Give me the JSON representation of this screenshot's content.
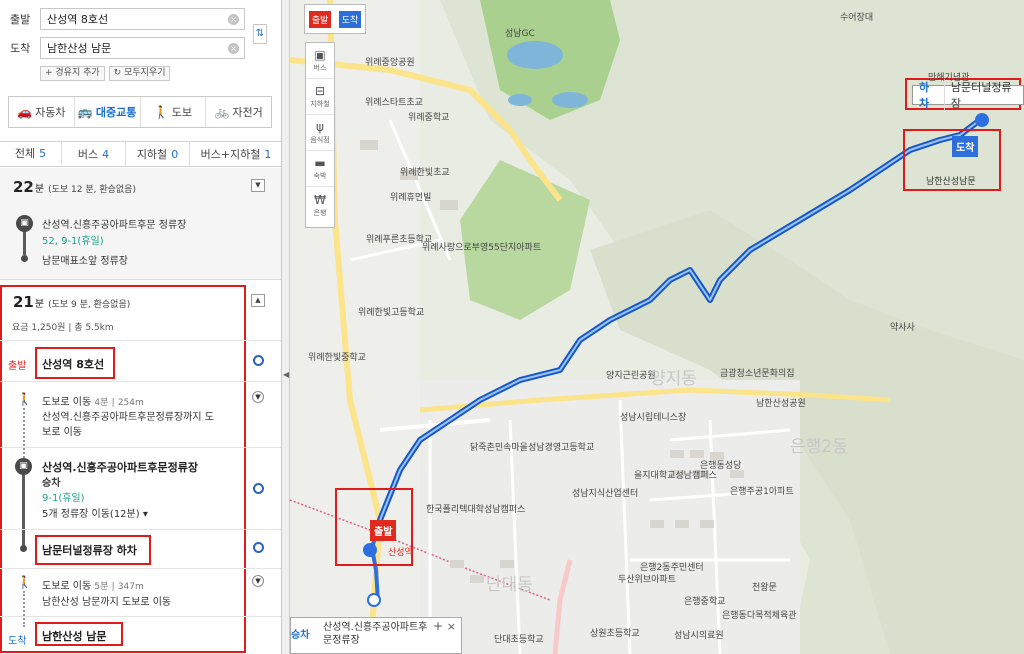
{
  "search": {
    "origin_label": "출발",
    "origin_value": "산성역 8호선",
    "destination_label": "도착",
    "destination_value": "남한산성 남문",
    "add_waypoint": "+ 경유지 추가",
    "clear_all": "모두지우기"
  },
  "modes": [
    {
      "label": "자동차",
      "icon": "car-icon",
      "glyph": "🚗"
    },
    {
      "label": "대중교통",
      "icon": "bus-icon",
      "glyph": "🚌"
    },
    {
      "label": "도보",
      "icon": "walk-icon",
      "glyph": "🚶"
    },
    {
      "label": "자전거",
      "icon": "bike-icon",
      "glyph": "🚲"
    }
  ],
  "result_tabs": [
    {
      "label": "전체",
      "count": "5"
    },
    {
      "label": "버스",
      "count": "4"
    },
    {
      "label": "지하철",
      "count": "0"
    },
    {
      "label": "버스+지하철",
      "count": "1"
    }
  ],
  "route1": {
    "time": "22",
    "unit": "분",
    "meta": "(도보 12 분, 환승없음)",
    "stop_from": "산성역.신흥주공아파트후문 정류장",
    "buses": "52, 9-1(휴일)",
    "stop_to": "남문매표소앞 정류장"
  },
  "route2": {
    "time": "21",
    "unit": "분",
    "meta": "(도보 9 분, 환승없음)",
    "fare": "요금 1,250원  |  총 5.5km",
    "start_label": "출발",
    "start_name": "산성역 8호선",
    "walk1_title": "도보로 이동",
    "walk1_time": "4분",
    "walk1_dist": "254m",
    "walk1_desc_1": "산성역.신흥주공아파트후문정류장까지 도",
    "walk1_desc_2": "보로 이동",
    "board_stop": "산성역.신흥주공아파트후문정류장",
    "board_label": "승차",
    "board_bus": "9-1(휴일)",
    "board_moves": "5개 정류장 이동(12분) ▾",
    "alight": "남문터널정류장 하차",
    "walk2_title": "도보로 이동",
    "walk2_time": "5분",
    "walk2_dist": "347m",
    "walk2_desc": "남한산성 남문까지 도보로 이동",
    "end_label": "도착",
    "end_name": "남한산성 남문"
  },
  "map": {
    "flag_start": "출발",
    "flag_end": "도착",
    "tools": [
      {
        "label": "버스",
        "icon": "bus-icon",
        "glyph": "▣"
      },
      {
        "label": "지하철",
        "icon": "subway-icon",
        "glyph": "⊟"
      },
      {
        "label": "음식점",
        "icon": "restaurant-icon",
        "glyph": "ψ"
      },
      {
        "label": "숙박",
        "icon": "bed-icon",
        "glyph": "▬"
      },
      {
        "label": "은행",
        "icon": "bank-icon",
        "glyph": "₩"
      }
    ],
    "callout_key": "하차",
    "callout_value": "남문터널정류장",
    "pin_end": "도착",
    "pin_end_caption": "남한산성남문",
    "pin_start": "출발",
    "tooltip_key": "승차",
    "tooltip_value": "산성역.신흥주공아파트후문정류장",
    "labels": [
      "성남GC",
      "위례중앙공원",
      "위례스타트초교",
      "위례중학교",
      "위례한빛초교",
      "위례휴먼빌",
      "위례푸른초등학교",
      "위례사랑으로부영55단지아파트",
      "위례한빛고등학교",
      "위례한빛중학교",
      "양지근린공원",
      "금광청소년문화의집",
      "남한산성공원",
      "성남시립테니스장",
      "닭죽촌민속마을",
      "성남경영고등학교",
      "을지대학교성남캠퍼스",
      "한국폴리텍대학성남캠퍼스",
      "은행동성당",
      "은행2동주민센터",
      "은행주공1아파트",
      "천왕문",
      "약사사",
      "만해기념관",
      "수어장대",
      "산성역",
      "단대초등학교",
      "두산위브아파트",
      "성남지식산업센터",
      "상원초등학교",
      "은행중학교",
      "은행동다목적체육관",
      "성남시의료원"
    ],
    "big_labels": [
      "양지동",
      "은행2동",
      "단대동"
    ]
  }
}
